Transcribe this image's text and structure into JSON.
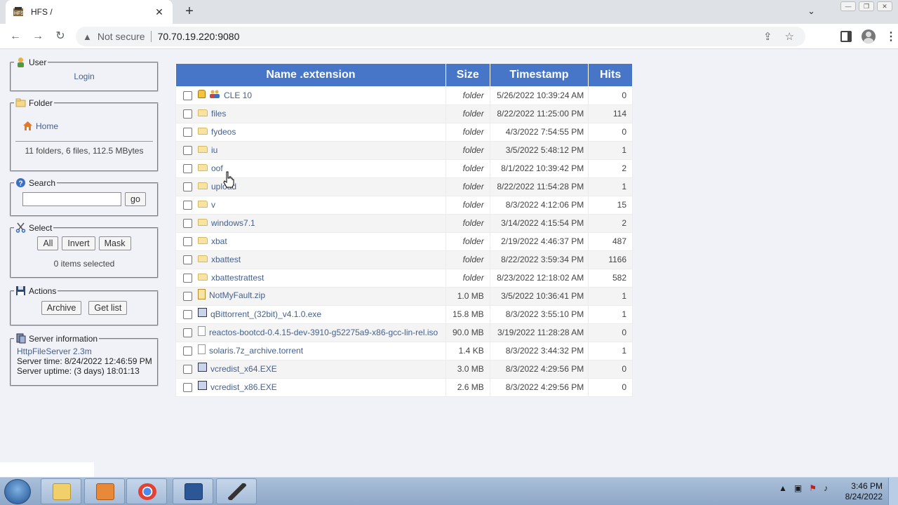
{
  "browser": {
    "tab_title": "HFS /",
    "new_tab_symbol": "+",
    "security_label": "Not secure",
    "url": "70.70.19.220:9080"
  },
  "sidebar": {
    "user": {
      "legend": "User",
      "login_label": "Login"
    },
    "folder": {
      "legend": "Folder",
      "home_label": "Home",
      "summary": "11 folders, 6 files, 112.5 MBytes"
    },
    "search": {
      "legend": "Search",
      "input_value": "",
      "go_label": "go"
    },
    "select": {
      "legend": "Select",
      "all_label": "All",
      "invert_label": "Invert",
      "mask_label": "Mask",
      "status": "0 items selected"
    },
    "actions": {
      "legend": "Actions",
      "archive_label": "Archive",
      "getlist_label": "Get list"
    },
    "server": {
      "legend": "Server information",
      "version_link": "HttpFileServer 2.3m",
      "time": "Server time: 8/24/2022 12:46:59 PM",
      "uptime": "Server uptime: (3 days) 18:01:13"
    }
  },
  "table": {
    "headers": {
      "name": "Name .extension",
      "size": "Size",
      "timestamp": "Timestamp",
      "hits": "Hits"
    },
    "rows": [
      {
        "name": "CLE 10",
        "icon": "locked-folder-icon",
        "size": "folder",
        "timestamp": "5/26/2022 10:39:24 AM",
        "hits": "0"
      },
      {
        "name": "files",
        "icon": "folder-icon",
        "size": "folder",
        "timestamp": "8/22/2022 11:25:00 PM",
        "hits": "114"
      },
      {
        "name": "fydeos",
        "icon": "folder-icon",
        "size": "folder",
        "timestamp": "4/3/2022 7:54:55 PM",
        "hits": "0"
      },
      {
        "name": "iu",
        "icon": "folder-icon",
        "size": "folder",
        "timestamp": "3/5/2022 5:48:12 PM",
        "hits": "1"
      },
      {
        "name": "oof",
        "icon": "folder-icon",
        "size": "folder",
        "timestamp": "8/1/2022 10:39:42 PM",
        "hits": "2"
      },
      {
        "name": "upload",
        "icon": "folder-icon",
        "size": "folder",
        "timestamp": "8/22/2022 11:54:28 PM",
        "hits": "1"
      },
      {
        "name": "v",
        "icon": "folder-icon",
        "size": "folder",
        "timestamp": "8/3/2022 4:12:06 PM",
        "hits": "15"
      },
      {
        "name": "windows7.1",
        "icon": "folder-icon",
        "size": "folder",
        "timestamp": "3/14/2022 4:15:54 PM",
        "hits": "2"
      },
      {
        "name": "xbat",
        "icon": "folder-icon",
        "size": "folder",
        "timestamp": "2/19/2022 4:46:37 PM",
        "hits": "487"
      },
      {
        "name": "xbattest",
        "icon": "folder-icon",
        "size": "folder",
        "timestamp": "8/22/2022 3:59:34 PM",
        "hits": "1166"
      },
      {
        "name": "xbattestrattest",
        "icon": "folder-icon",
        "size": "folder",
        "timestamp": "8/23/2022 12:18:02 AM",
        "hits": "582"
      },
      {
        "name": "NotMyFault.zip",
        "icon": "zip-file-icon",
        "size": "1.0 MB",
        "timestamp": "3/5/2022 10:36:41 PM",
        "hits": "1"
      },
      {
        "name": "qBittorrent_(32bit)_v4.1.0.exe",
        "icon": "exe-file-icon",
        "size": "15.8 MB",
        "timestamp": "8/3/2022 3:55:10 PM",
        "hits": "1"
      },
      {
        "name": "reactos-bootcd-0.4.15-dev-3910-g52275a9-x86-gcc-lin-rel.iso",
        "icon": "file-icon",
        "size": "90.0 MB",
        "timestamp": "3/19/2022 11:28:28 AM",
        "hits": "0"
      },
      {
        "name": "solaris.7z_archive.torrent",
        "icon": "file-icon",
        "size": "1.4 KB",
        "timestamp": "8/3/2022 3:44:32 PM",
        "hits": "1"
      },
      {
        "name": "vcredist_x64.EXE",
        "icon": "exe-file-icon",
        "size": "3.0 MB",
        "timestamp": "8/3/2022 4:29:56 PM",
        "hits": "0"
      },
      {
        "name": "vcredist_x86.EXE",
        "icon": "exe-file-icon",
        "size": "2.6 MB",
        "timestamp": "8/3/2022 4:29:56 PM",
        "hits": "0"
      }
    ]
  },
  "taskbar": {
    "clock_time": "3:46 PM",
    "clock_date": "8/24/2022"
  }
}
